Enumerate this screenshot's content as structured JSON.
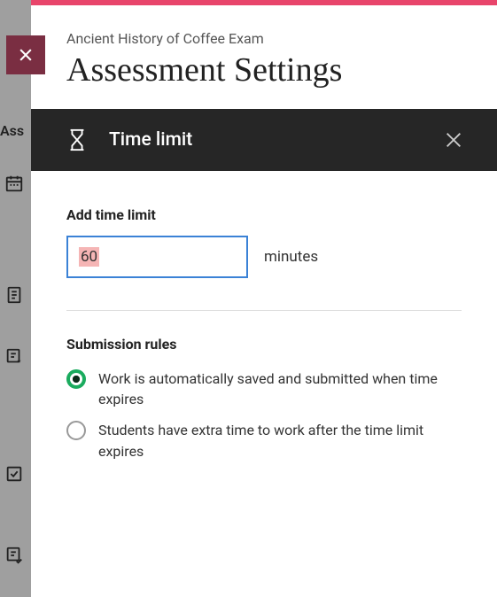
{
  "background": {
    "nav_label": "Ass"
  },
  "header": {
    "breadcrumb": "Ancient History of Coffee Exam",
    "title": "Assessment Settings"
  },
  "dark_bar": {
    "title": "Time limit"
  },
  "time_limit": {
    "label": "Add time limit",
    "value": "60",
    "unit": "minutes"
  },
  "submission": {
    "label": "Submission rules",
    "options": [
      {
        "text": "Work is automatically saved and submitted when time expires",
        "selected": true
      },
      {
        "text": "Students have extra time to work after the time limit expires",
        "selected": false
      }
    ]
  }
}
